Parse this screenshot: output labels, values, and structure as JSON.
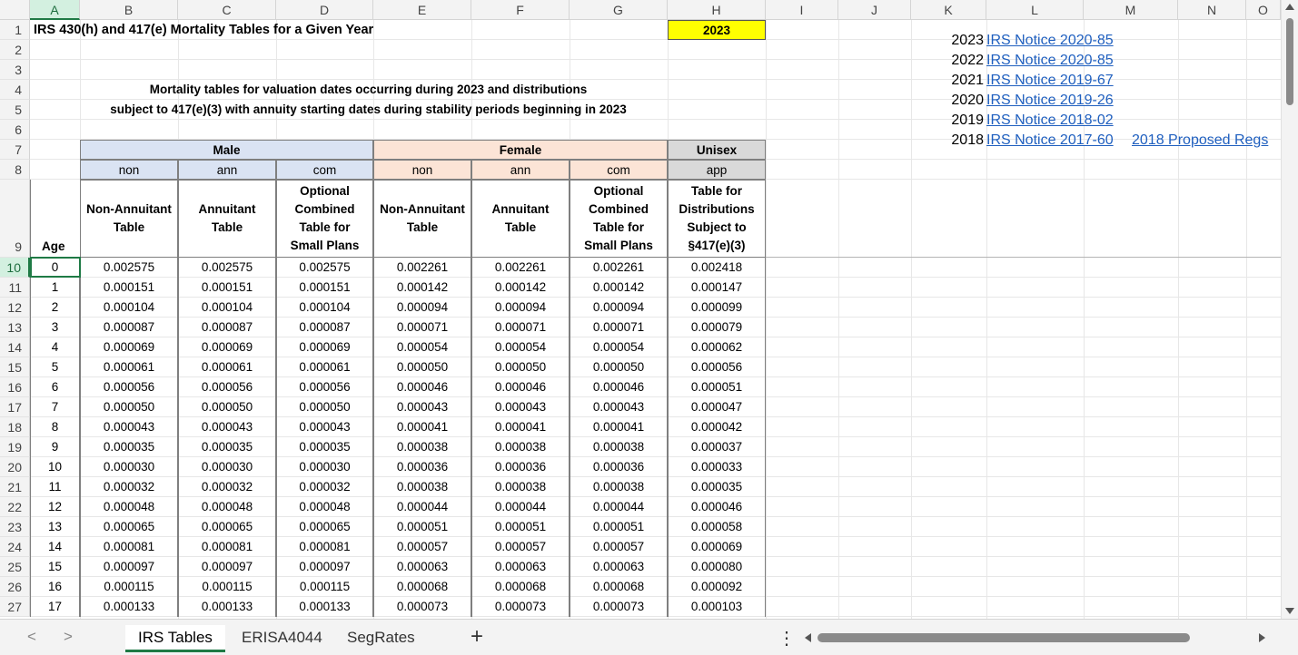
{
  "columns": [
    "A",
    "B",
    "C",
    "D",
    "E",
    "F",
    "G",
    "H",
    "I",
    "J",
    "K",
    "L",
    "M",
    "N",
    "O"
  ],
  "row_numbers": [
    "1",
    "2",
    "3",
    "4",
    "5",
    "6",
    "7",
    "8",
    "9",
    "10",
    "11",
    "12",
    "13",
    "14",
    "15",
    "16",
    "17",
    "18",
    "19",
    "20",
    "21",
    "22",
    "23",
    "24",
    "25",
    "26",
    "27"
  ],
  "title": "IRS 430(h) and 417(e) Mortality Tables for a Given Year",
  "year_value": "2023",
  "subtitle_line1": "Mortality tables for valuation dates occurring during 2023 and distributions",
  "subtitle_line2": "subject to 417(e)(3) with annuity starting dates during stability periods beginning in 2023",
  "groups": {
    "male": "Male",
    "female": "Female",
    "unisex": "Unisex"
  },
  "codes": [
    "non",
    "ann",
    "com",
    "non",
    "ann",
    "com",
    "app"
  ],
  "headers": [
    [
      "Non-Annuitant",
      "Table"
    ],
    [
      "Annuitant",
      "Table"
    ],
    [
      "Optional",
      "Combined",
      "Table for",
      "Small Plans"
    ],
    [
      "Non-Annuitant",
      "Table"
    ],
    [
      "Annuitant",
      "Table"
    ],
    [
      "Optional",
      "Combined",
      "Table for",
      "Small Plans"
    ],
    [
      "Table for",
      "Distributions",
      "Subject to",
      "§417(e)(3)"
    ]
  ],
  "age_label": "Age",
  "data_rows": [
    [
      "0",
      "0.002575",
      "0.002575",
      "0.002575",
      "0.002261",
      "0.002261",
      "0.002261",
      "0.002418"
    ],
    [
      "1",
      "0.000151",
      "0.000151",
      "0.000151",
      "0.000142",
      "0.000142",
      "0.000142",
      "0.000147"
    ],
    [
      "2",
      "0.000104",
      "0.000104",
      "0.000104",
      "0.000094",
      "0.000094",
      "0.000094",
      "0.000099"
    ],
    [
      "3",
      "0.000087",
      "0.000087",
      "0.000087",
      "0.000071",
      "0.000071",
      "0.000071",
      "0.000079"
    ],
    [
      "4",
      "0.000069",
      "0.000069",
      "0.000069",
      "0.000054",
      "0.000054",
      "0.000054",
      "0.000062"
    ],
    [
      "5",
      "0.000061",
      "0.000061",
      "0.000061",
      "0.000050",
      "0.000050",
      "0.000050",
      "0.000056"
    ],
    [
      "6",
      "0.000056",
      "0.000056",
      "0.000056",
      "0.000046",
      "0.000046",
      "0.000046",
      "0.000051"
    ],
    [
      "7",
      "0.000050",
      "0.000050",
      "0.000050",
      "0.000043",
      "0.000043",
      "0.000043",
      "0.000047"
    ],
    [
      "8",
      "0.000043",
      "0.000043",
      "0.000043",
      "0.000041",
      "0.000041",
      "0.000041",
      "0.000042"
    ],
    [
      "9",
      "0.000035",
      "0.000035",
      "0.000035",
      "0.000038",
      "0.000038",
      "0.000038",
      "0.000037"
    ],
    [
      "10",
      "0.000030",
      "0.000030",
      "0.000030",
      "0.000036",
      "0.000036",
      "0.000036",
      "0.000033"
    ],
    [
      "11",
      "0.000032",
      "0.000032",
      "0.000032",
      "0.000038",
      "0.000038",
      "0.000038",
      "0.000035"
    ],
    [
      "12",
      "0.000048",
      "0.000048",
      "0.000048",
      "0.000044",
      "0.000044",
      "0.000044",
      "0.000046"
    ],
    [
      "13",
      "0.000065",
      "0.000065",
      "0.000065",
      "0.000051",
      "0.000051",
      "0.000051",
      "0.000058"
    ],
    [
      "14",
      "0.000081",
      "0.000081",
      "0.000081",
      "0.000057",
      "0.000057",
      "0.000057",
      "0.000069"
    ],
    [
      "15",
      "0.000097",
      "0.000097",
      "0.000097",
      "0.000063",
      "0.000063",
      "0.000063",
      "0.000080"
    ],
    [
      "16",
      "0.000115",
      "0.000115",
      "0.000115",
      "0.000068",
      "0.000068",
      "0.000068",
      "0.000092"
    ],
    [
      "17",
      "0.000133",
      "0.000133",
      "0.000133",
      "0.000073",
      "0.000073",
      "0.000073",
      "0.000103"
    ]
  ],
  "notices": [
    {
      "year": "2023",
      "label": "IRS Notice 2020-85"
    },
    {
      "year": "2022",
      "label": "IRS Notice 2020-85"
    },
    {
      "year": "2021",
      "label": "IRS Notice 2019-67"
    },
    {
      "year": "2020",
      "label": "IRS Notice 2019-26"
    },
    {
      "year": "2019",
      "label": "IRS Notice 2018-02"
    },
    {
      "year": "2018",
      "label": "IRS Notice 2017-60"
    }
  ],
  "proposed_regs": "2018 Proposed Regs",
  "sheet_tabs": [
    "IRS Tables",
    "ERISA4044",
    "SegRates"
  ],
  "add_sheet": "+",
  "nav_prev": "<",
  "nav_next": ">",
  "more_menu": "⋮",
  "colors": {
    "yellow": "#ffff00",
    "male_fill": "#dae3f3",
    "female_fill": "#fce4d6",
    "unisex_fill": "#d9d9d9",
    "link": "#1f5fbf",
    "accent": "#1f7a45"
  }
}
